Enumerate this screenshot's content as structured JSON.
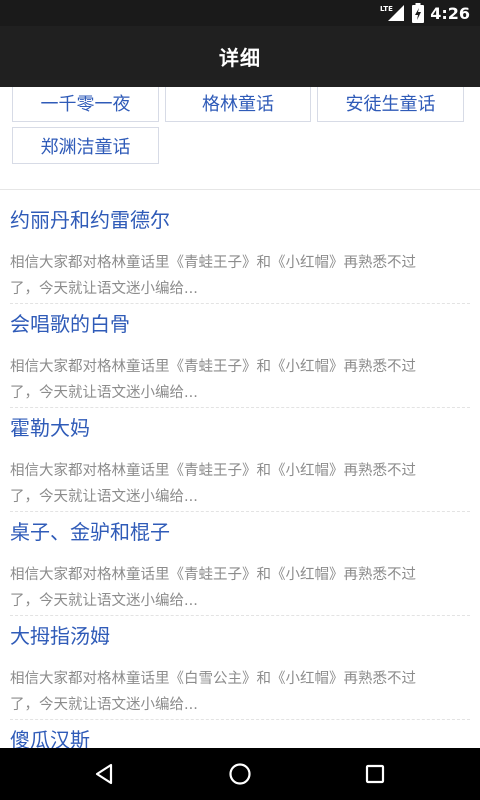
{
  "status_bar": {
    "network_label": "LTE",
    "time": "4:26"
  },
  "app_bar": {
    "title": "详细"
  },
  "categories": [
    {
      "label": "一千零一夜"
    },
    {
      "label": "格林童话"
    },
    {
      "label": "安徒生童话"
    },
    {
      "label": "郑渊洁童话"
    }
  ],
  "articles": [
    {
      "title": "约丽丹和约雷德尔",
      "desc_line1": "相信大家都对格林童话里《青蛙王子》和《小红帽》再熟悉不过",
      "desc_line2": "了，今天就让语文迷小编给..."
    },
    {
      "title": "会唱歌的白骨",
      "desc_line1": "相信大家都对格林童话里《青蛙王子》和《小红帽》再熟悉不过",
      "desc_line2": "了，今天就让语文迷小编给..."
    },
    {
      "title": "霍勒大妈",
      "desc_line1": "相信大家都对格林童话里《青蛙王子》和《小红帽》再熟悉不过",
      "desc_line2": "了，今天就让语文迷小编给..."
    },
    {
      "title": "桌子、金驴和棍子",
      "desc_line1": "相信大家都对格林童话里《青蛙王子》和《小红帽》再熟悉不过",
      "desc_line2": "了，今天就让语文迷小编给..."
    },
    {
      "title": "大拇指汤姆",
      "desc_line1": "相信大家都对格林童话里《白雪公主》和《小红帽》再熟悉不过",
      "desc_line2": "了，今天就让语文迷小编给..."
    },
    {
      "title": "傻瓜汉斯",
      "desc_line1": "",
      "desc_line2": ""
    }
  ],
  "colors": {
    "link_blue": "#2f5bb8",
    "app_bar": "#202020",
    "desc_gray": "#8c8c8c"
  },
  "icons": {
    "signal": "signal-icon",
    "battery": "battery-icon",
    "back": "back-icon",
    "home": "home-icon",
    "recents": "recents-icon"
  }
}
